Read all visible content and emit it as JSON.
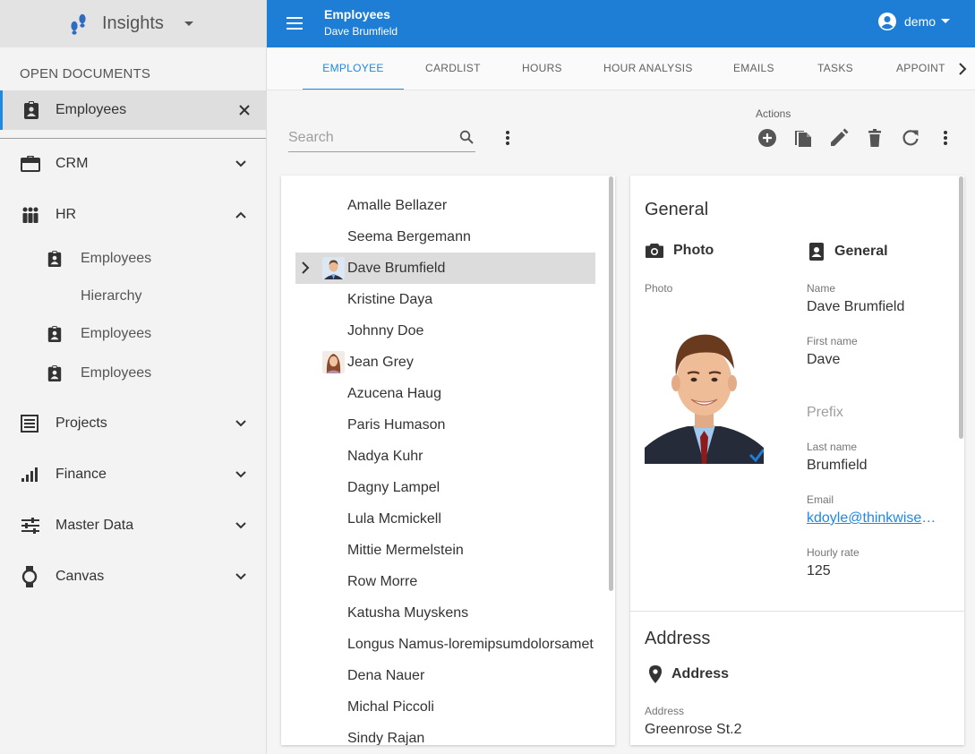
{
  "sidebar": {
    "brand_title": "Insights",
    "open_documents_label": "OPEN DOCUMENTS",
    "open_document": {
      "label": "Employees"
    },
    "nav": [
      {
        "label": "CRM"
      },
      {
        "label": "HR"
      },
      {
        "label": "Projects"
      },
      {
        "label": "Finance"
      },
      {
        "label": "Master Data"
      },
      {
        "label": "Canvas"
      }
    ],
    "hr_sub": [
      {
        "label": "Employees"
      },
      {
        "label": "Hierarchy"
      },
      {
        "label": "Employees"
      },
      {
        "label": "Employees"
      }
    ]
  },
  "topbar": {
    "title": "Employees",
    "subtitle": "Dave Brumfield",
    "user": "demo",
    "accent": "#1e7ed6"
  },
  "tabs": [
    "EMPLOYEE",
    "CARDLIST",
    "HOURS",
    "HOUR ANALYSIS",
    "EMAILS",
    "TASKS",
    "APPOINT"
  ],
  "toolbar": {
    "search_placeholder": "Search",
    "actions_label": "Actions"
  },
  "employees": [
    "Amalle Bellazer",
    "Seema Bergemann",
    "Dave Brumfield",
    "Kristine Daya",
    "Johnny Doe",
    "Jean Grey",
    "Azucena Haug",
    "Paris Humason",
    "Nadya Kuhr",
    "Dagny Lampel",
    "Lula Mcmickell",
    "Mittie Mermelstein",
    "Row Morre",
    "Katusha Muyskens",
    "Longus Namus-loremipsumdolorsamet",
    "Dena Nauer",
    "Michal Piccoli",
    "Sindy Rajan"
  ],
  "detail": {
    "general_title": "General",
    "photo_group": "Photo",
    "general_group": "General",
    "photo_label": "Photo",
    "name_label": "Name",
    "name_value": "Dave Brumfield",
    "first_name_label": "First name",
    "first_name_value": "Dave",
    "prefix_label": "Prefix",
    "last_name_label": "Last name",
    "last_name_value": "Brumfield",
    "email_label": "Email",
    "email_value": "kdoyle@thinkwises…",
    "hourly_rate_label": "Hourly rate",
    "hourly_rate_value": "125",
    "address_title": "Address",
    "address_group": "Address",
    "address_label": "Address",
    "address_value": "Greenrose St.2"
  }
}
